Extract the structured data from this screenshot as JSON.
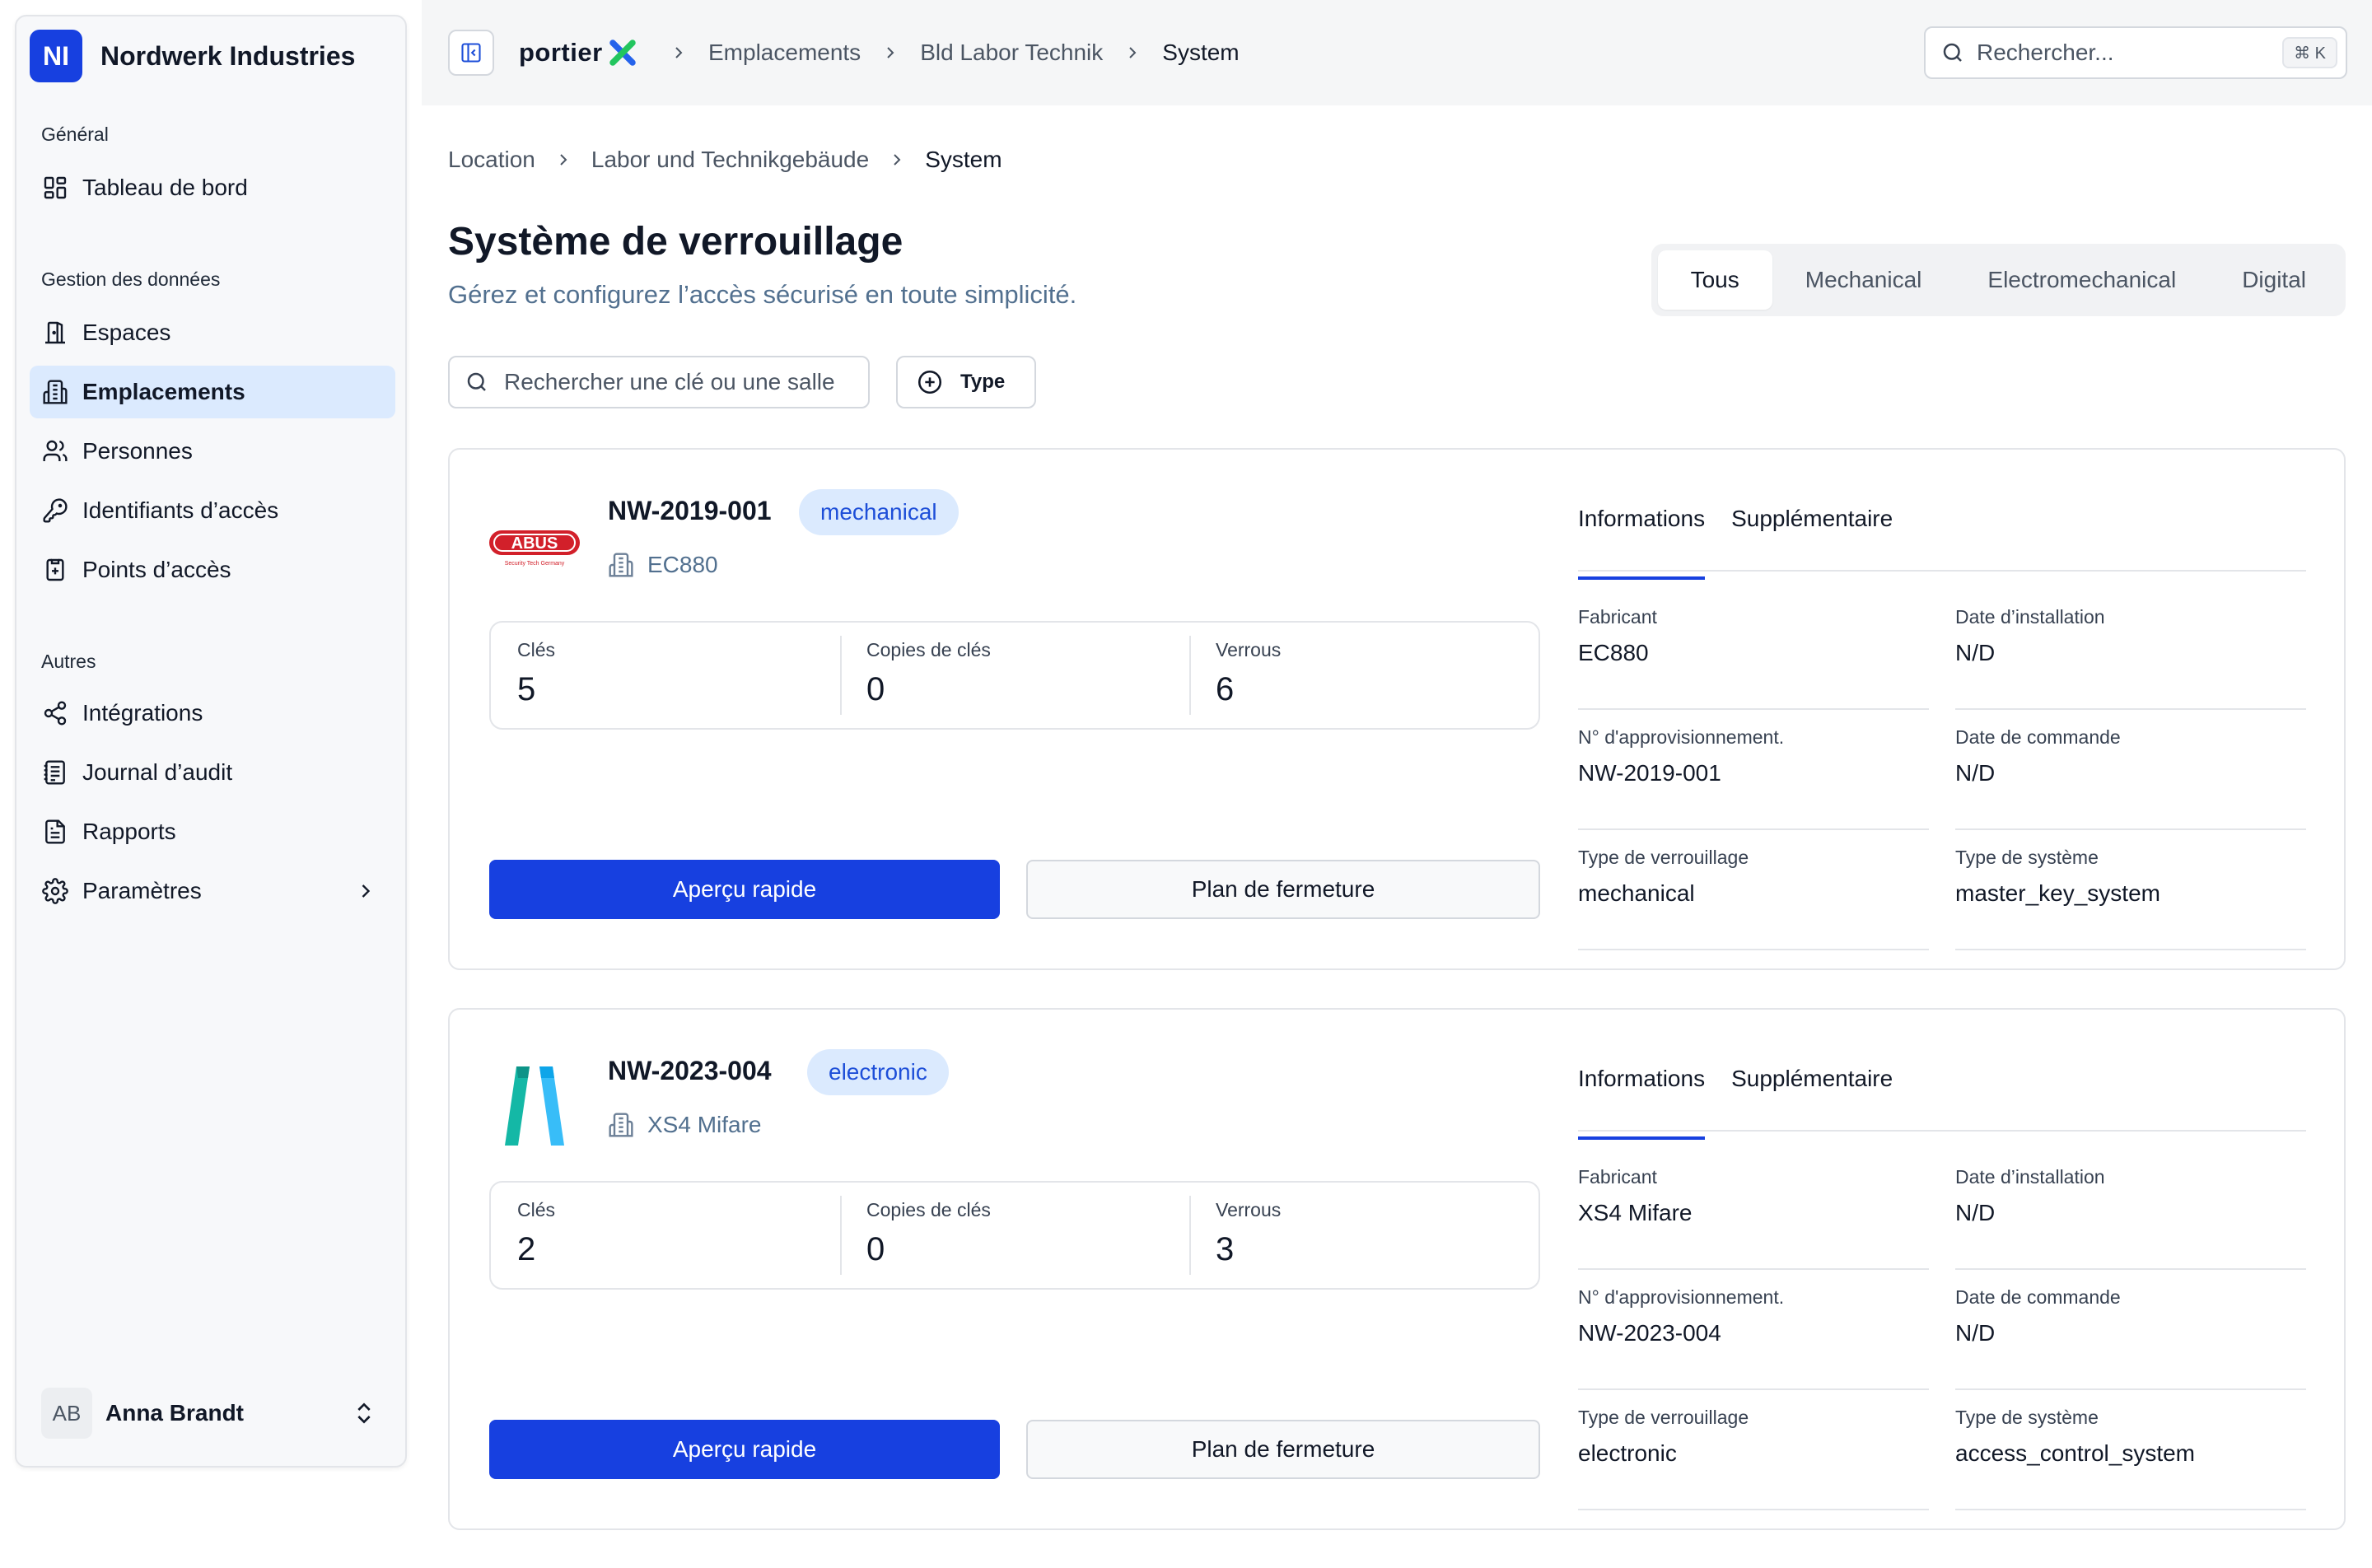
{
  "org": {
    "initials": "NI",
    "name": "Nordwerk Industries"
  },
  "sidebar": {
    "sections": [
      {
        "title": "Général",
        "items": [
          {
            "label": "Tableau de bord",
            "icon": "dashboard-icon"
          }
        ]
      },
      {
        "title": "Gestion des données",
        "items": [
          {
            "label": "Espaces",
            "icon": "door-icon"
          },
          {
            "label": "Emplacements",
            "icon": "building-icon",
            "active": true
          },
          {
            "label": "Personnes",
            "icon": "users-icon"
          },
          {
            "label": "Identifiants d’accès",
            "icon": "key-icon"
          },
          {
            "label": "Points d’accès",
            "icon": "access-point-icon"
          }
        ]
      },
      {
        "title": "Autres",
        "items": [
          {
            "label": "Intégrations",
            "icon": "share-icon"
          },
          {
            "label": "Journal d’audit",
            "icon": "log-icon"
          },
          {
            "label": "Rapports",
            "icon": "report-icon"
          },
          {
            "label": "Paramètres",
            "icon": "settings-icon"
          }
        ]
      }
    ],
    "user": {
      "initials": "AB",
      "name": "Anna Brandt"
    }
  },
  "topbar": {
    "brand": "portier",
    "breadcrumbs": [
      "Emplacements",
      "Bld Labor Technik",
      "System"
    ],
    "search_placeholder": "Rechercher...",
    "search_shortcut": "⌘ K"
  },
  "page": {
    "breadcrumbs": [
      "Location",
      "Labor und Technikgebäude",
      "System"
    ],
    "title": "Système de verrouillage",
    "subtitle": "Gérez et configurez l’accès sécurisé en toute simplicité.",
    "tabs": [
      "Tous",
      "Mechanical",
      "Electromechanical",
      "Digital"
    ],
    "active_tab": "Tous",
    "filter_placeholder": "Rechercher une clé ou une salle",
    "type_button": "Type"
  },
  "labels": {
    "keys": "Clés",
    "key_copies": "Copies de clés",
    "locks": "Verrous",
    "quick_view": "Aperçu rapide",
    "locking_plan": "Plan de fermeture",
    "tab_info": "Informations",
    "tab_extra": "Supplémentaire",
    "manufacturer": "Fabricant",
    "install_date": "Date d’installation",
    "supply_no": "N° d'approvisionnement.",
    "order_date": "Date de commande",
    "lock_type": "Type de verrouillage",
    "system_type": "Type de système"
  },
  "systems": [
    {
      "id": "NW-2019-001",
      "badge": "mechanical",
      "manufacturer": "EC880",
      "logo_text": "ABUS",
      "logo_tagline": "Security Tech Germany",
      "keys": "5",
      "key_copies": "0",
      "locks": "6",
      "info": {
        "manufacturer": "EC880",
        "install_date": "N/D",
        "supply_no": "NW-2019-001",
        "order_date": "N/D",
        "lock_type": "mechanical",
        "system_type": "master_key_system"
      }
    },
    {
      "id": "NW-2023-004",
      "badge": "electronic",
      "manufacturer": "XS4 Mifare",
      "keys": "2",
      "key_copies": "0",
      "locks": "3",
      "info": {
        "manufacturer": "XS4 Mifare",
        "install_date": "N/D",
        "supply_no": "NW-2023-004",
        "order_date": "N/D",
        "lock_type": "electronic",
        "system_type": "access_control_system"
      }
    }
  ],
  "colors": {
    "primary": "#1740e0",
    "badge_bg": "#dbeafe",
    "active_nav": "#dbeafe",
    "abus_red": "#d2202a"
  }
}
